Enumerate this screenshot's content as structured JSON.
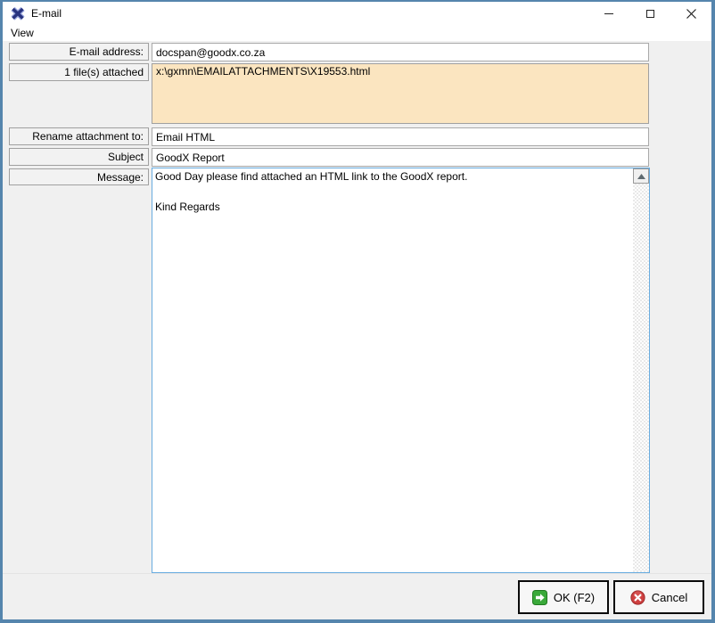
{
  "window": {
    "title": "E-mail"
  },
  "menu": {
    "view": "View"
  },
  "form": {
    "email": {
      "label": "E-mail address:",
      "value": "docspan@goodx.co.za"
    },
    "attachments": {
      "label": "1 file(s) attached",
      "value": "x:\\gxmn\\EMAILATTACHMENTS\\X19553.html"
    },
    "rename": {
      "label": "Rename attachment to:",
      "value": "Email HTML"
    },
    "subject": {
      "label": "Subject",
      "value": "GoodX Report"
    },
    "message": {
      "label": "Message:",
      "value": "Good Day please find attached an HTML link to the GoodX report.\n\nKind Regards"
    }
  },
  "buttons": {
    "ok": "OK (F2)",
    "cancel": "Cancel"
  },
  "icons": {
    "app": "goodx-x-logo",
    "minimize": "minimize-icon",
    "maximize": "maximize-icon",
    "close": "close-icon",
    "ok": "green-forward-arrow-icon",
    "cancel": "red-cross-icon",
    "scroll_up": "up-arrow-icon"
  },
  "colors": {
    "window_border": "#5585ad",
    "content_bg": "#f0f0f0",
    "attachment_bg": "#fbe5c0",
    "message_border": "#68ace0",
    "ok_icon_green": "#3aa93a",
    "cancel_icon_red": "#cf4040"
  }
}
